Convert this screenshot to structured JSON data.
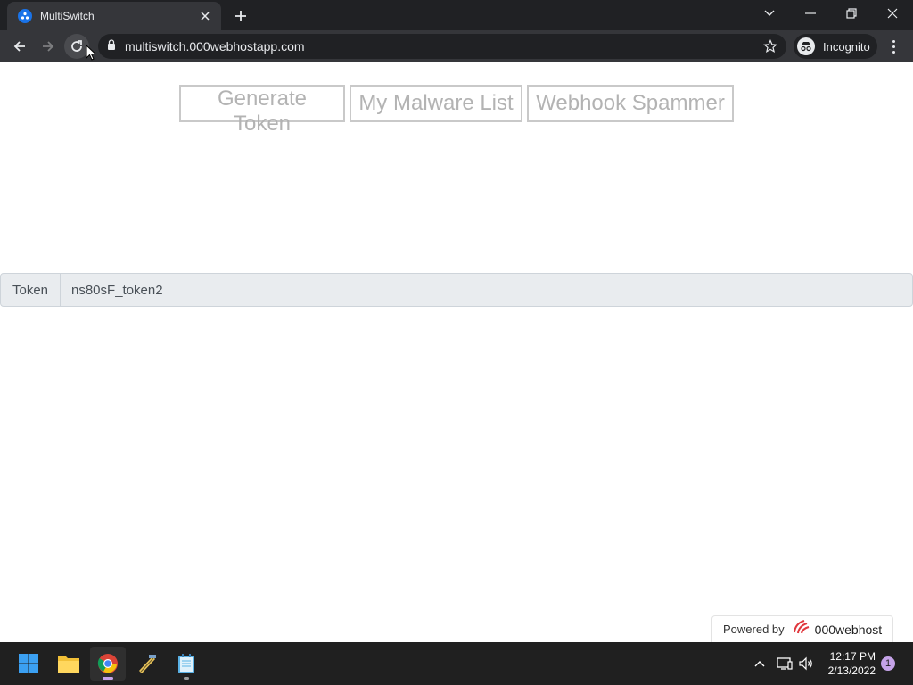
{
  "browser": {
    "tab": {
      "title": "MultiSwitch"
    },
    "address_bar": {
      "url": "multiswitch.000webhostapp.com"
    },
    "incognito_label": "Incognito"
  },
  "page": {
    "buttons": {
      "generate_token": "Generate Token",
      "malware_list": "My Malware List",
      "webhook_spammer": "Webhook Spammer"
    },
    "token_field": {
      "label": "Token",
      "value": "ns80sF_token2"
    },
    "footer": {
      "powered_by": "Powered by",
      "brand": "000webhost"
    }
  },
  "taskbar": {
    "time": "12:17 PM",
    "date": "2/13/2022",
    "notification_count": "1",
    "apps": [
      "start-icon",
      "file-explorer-icon",
      "chrome-icon",
      "app-icon",
      "notepad-icon"
    ]
  },
  "colors": {
    "chrome_dark": "#202124",
    "chrome_tab": "#35363a",
    "button_text": "#b3b3b3",
    "input_bg": "#e9ecef",
    "taskbar": "#202020"
  }
}
